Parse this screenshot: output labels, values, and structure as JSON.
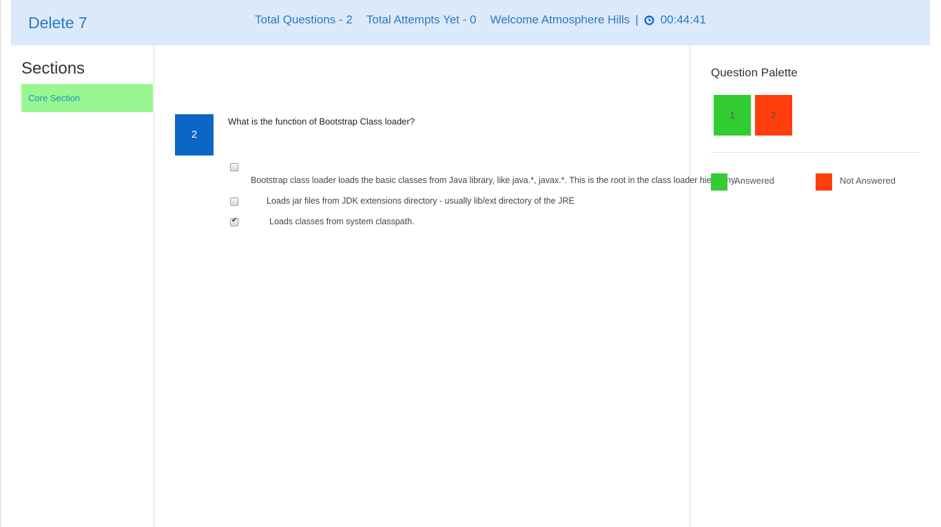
{
  "header": {
    "title": "Delete 7",
    "total_questions": "Total Questions - 2",
    "total_attempts": "Total Attempts Yet - 0",
    "welcome": "Welcome Atmosphere Hills",
    "separator": "|",
    "clock_icon": "clock-icon",
    "timer": "00:44:41"
  },
  "sections": {
    "title": "Sections",
    "items": [
      {
        "label": "Core Section"
      }
    ]
  },
  "question": {
    "number": "2",
    "text": "What is the function of Bootstrap Class loader?",
    "options": [
      {
        "text": "Bootstrap class loader loads the basic classes from Java library, like java.*, javax.*. This is the root in the class loader hierarchy.",
        "checked": false
      },
      {
        "text": "Loads jar files from JDK extensions directory - usually lib/ext directory of the JRE",
        "checked": false
      },
      {
        "text": "Loads classes from system classpath.",
        "checked": true
      }
    ]
  },
  "palette": {
    "title": "Question Palette",
    "buttons": [
      {
        "label": "1",
        "status": "answered"
      },
      {
        "label": "2",
        "status": "not-answered"
      }
    ],
    "legend": {
      "answered": "Answered",
      "not_answered": "Not Answered"
    }
  },
  "colors": {
    "header_bg": "#dce9fb",
    "accent_blue": "#2a7ac0",
    "question_badge": "#0b66c6",
    "answered": "#33cc33",
    "not_answered": "#ff3d0d",
    "section_active": "#99f792"
  }
}
